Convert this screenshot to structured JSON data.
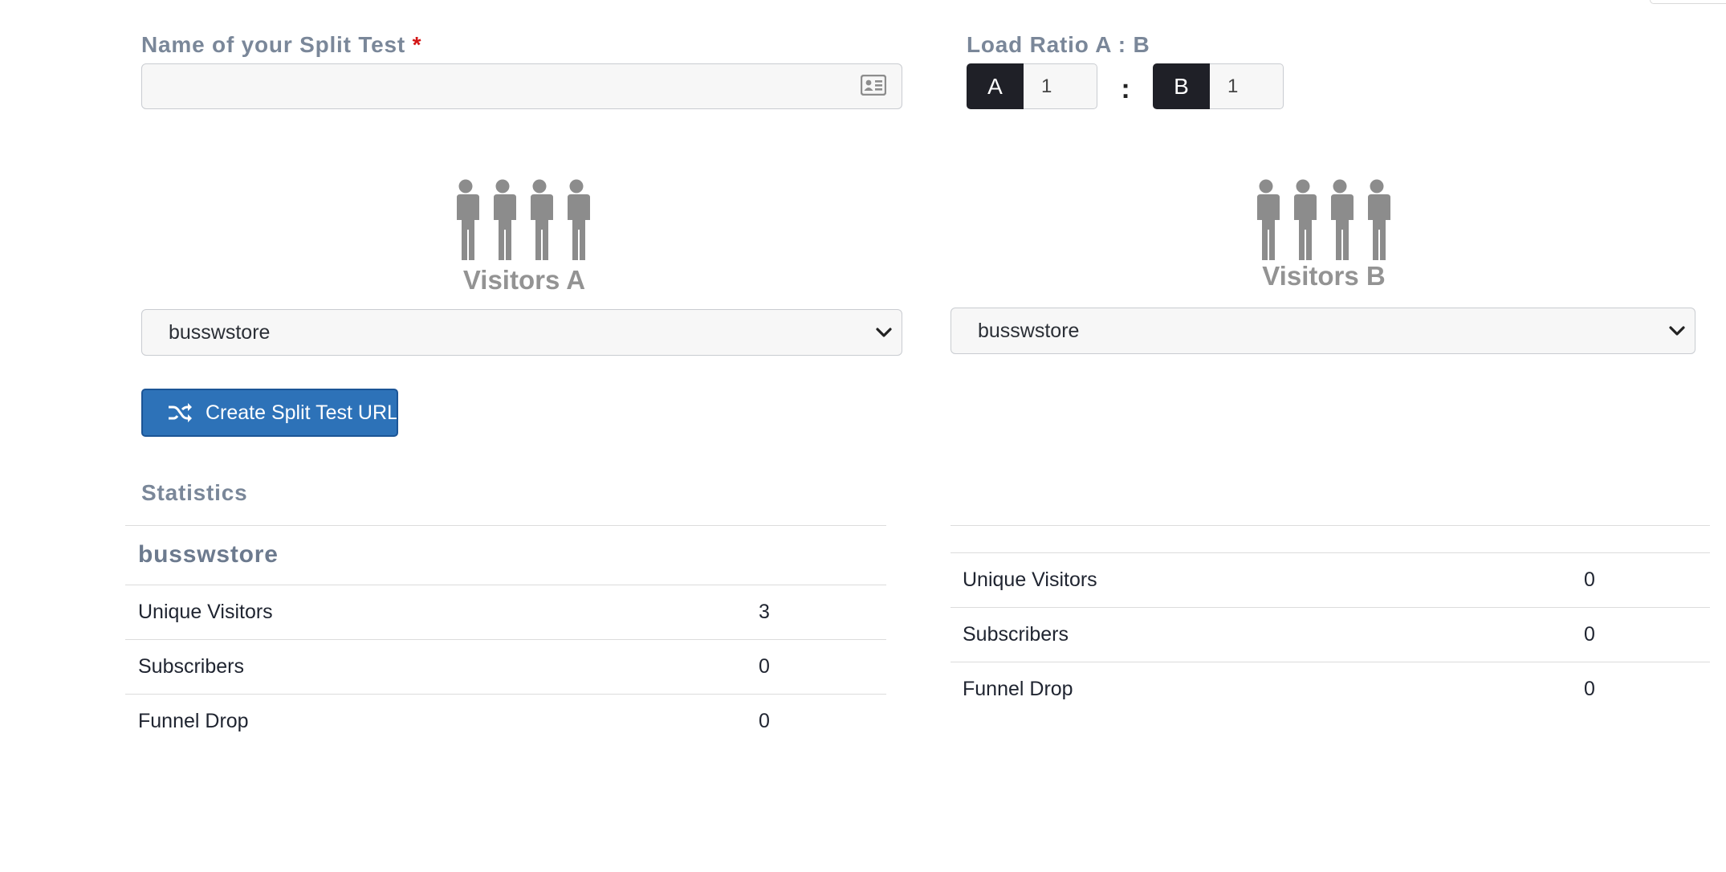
{
  "form": {
    "name_label": "Name of your Split Test",
    "required_mark": "*",
    "name_value": "",
    "ratio_label": "Load Ratio A : B",
    "ratio_a_badge": "A",
    "ratio_a_value": "1",
    "ratio_separator": ":",
    "ratio_b_badge": "B",
    "ratio_b_value": "1"
  },
  "visitors": {
    "a_caption": "Visitors A",
    "b_caption": "Visitors B",
    "a_selected": "busswstore",
    "b_selected": "busswstore"
  },
  "actions": {
    "create_label": "Create Split Test URL"
  },
  "statistics": {
    "title": "Statistics",
    "a": {
      "name": "busswstore",
      "rows": [
        {
          "label": "Unique Visitors",
          "value": "3"
        },
        {
          "label": "Subscribers",
          "value": "0"
        },
        {
          "label": "Funnel Drop",
          "value": "0"
        }
      ]
    },
    "b": {
      "name": "",
      "rows": [
        {
          "label": "Unique Visitors",
          "value": "0"
        },
        {
          "label": "Subscribers",
          "value": "0"
        },
        {
          "label": "Funnel Drop",
          "value": "0"
        }
      ]
    }
  },
  "icons": {
    "name_field": "contact-card-icon",
    "select_chevron": "chevron-down-icon",
    "create": "shuffle-icon",
    "visitors": "people-group-icon"
  },
  "colors": {
    "label": "#7a8799",
    "required": "#d31515",
    "primary_button": "#2d72b8",
    "ratio_badge": "#1f2027"
  }
}
